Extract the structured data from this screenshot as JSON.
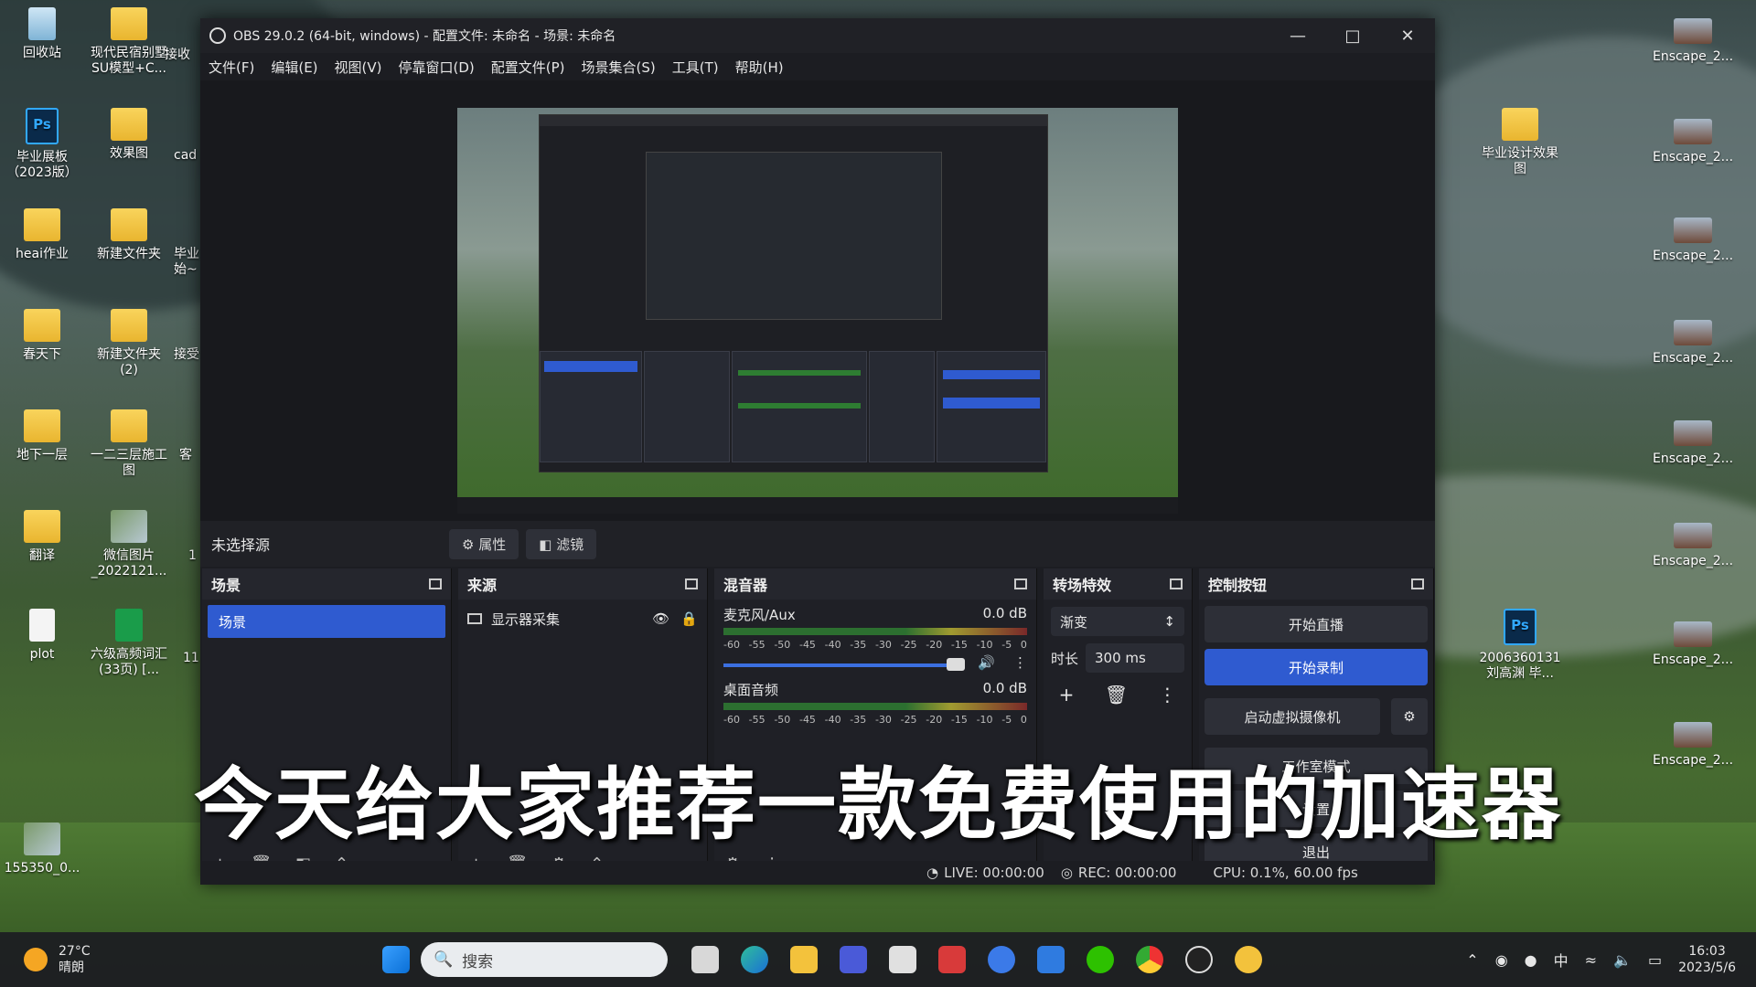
{
  "desktop": {
    "left_icons": [
      {
        "label": "回收站",
        "kind": "bin"
      },
      {
        "label": "现代民宿别墅SU模型+C...",
        "kind": "folder"
      },
      {
        "label": "毕业展板（2023版）",
        "kind": "psd"
      },
      {
        "label": "效果图",
        "kind": "folder"
      },
      {
        "label": "heai作业",
        "kind": "folder"
      },
      {
        "label": "新建文件夹",
        "kind": "folder"
      },
      {
        "label": "春天下",
        "kind": "folder"
      },
      {
        "label": "新建文件夹 (2)",
        "kind": "folder"
      },
      {
        "label": "地下一层",
        "kind": "folder"
      },
      {
        "label": "一二三层施工图",
        "kind": "folder"
      },
      {
        "label": "翻译",
        "kind": "folder"
      },
      {
        "label": "微信图片_2022121...",
        "kind": "pic"
      },
      {
        "label": "plot",
        "kind": "doc"
      },
      {
        "label": "六级高频词汇 (33页) [...",
        "kind": "pdf"
      },
      {
        "label": "155350_0...",
        "kind": "pic"
      }
    ],
    "partial_icons": [
      "接收",
      "cad",
      "毕业始~",
      "接受",
      "客",
      "1",
      "11"
    ],
    "right_icons": [
      {
        "label": "Enscape_2..."
      },
      {
        "label": "Enscape_2..."
      },
      {
        "label": "Enscape_2..."
      },
      {
        "label": "Enscape_2..."
      },
      {
        "label": "Enscape_2..."
      },
      {
        "label": "Enscape_2..."
      },
      {
        "label": "Enscape_2..."
      },
      {
        "label": "Enscape_2..."
      }
    ],
    "mid_icons": [
      {
        "label": "毕业设计效果图",
        "kind": "folder"
      },
      {
        "label": "2006360131 刘高渊 毕...",
        "kind": "psd"
      }
    ]
  },
  "obs": {
    "title": "OBS 29.0.2 (64-bit, windows) - 配置文件: 未命名 - 场景: 未命名",
    "menu": [
      "文件(F)",
      "编辑(E)",
      "视图(V)",
      "停靠窗口(D)",
      "配置文件(P)",
      "场景集合(S)",
      "工具(T)",
      "帮助(H)"
    ],
    "source_bar": {
      "no_source": "未选择源",
      "properties": "属性",
      "filters": "滤镜"
    },
    "scenes": {
      "title": "场景",
      "items": [
        "场景"
      ]
    },
    "sources": {
      "title": "来源",
      "items": [
        "显示器采集"
      ]
    },
    "mixer": {
      "title": "混音器",
      "channels": [
        {
          "name": "麦克风/Aux",
          "db": "0.0 dB"
        },
        {
          "name": "桌面音频",
          "db": "0.0 dB"
        }
      ],
      "scale": [
        "-60",
        "-55",
        "-50",
        "-45",
        "-40",
        "-35",
        "-30",
        "-25",
        "-20",
        "-15",
        "-10",
        "-5",
        "0"
      ]
    },
    "transitions": {
      "title": "转场特效",
      "type": "渐变",
      "duration_label": "时长",
      "duration": "300 ms"
    },
    "controls": {
      "title": "控制按钮",
      "buttons": [
        "开始直播",
        "开始录制",
        "启动虚拟摄像机",
        "工作室模式",
        "设置",
        "退出"
      ]
    },
    "status": {
      "live": "LIVE: 00:00:00",
      "rec": "REC: 00:00:00",
      "cpu": "CPU: 0.1%, 60.00 fps"
    }
  },
  "subtitle": "今天给大家推荐一款免费使用的加速器",
  "taskbar": {
    "weather_temp": "27°C",
    "weather_desc": "晴朗",
    "search_placeholder": "搜索",
    "time": "16:03",
    "date": "2023/5/6",
    "ime": "中"
  },
  "colors": {
    "accent": "#2f5bd0",
    "panel": "#1f2026",
    "titlebar": "#202126"
  }
}
